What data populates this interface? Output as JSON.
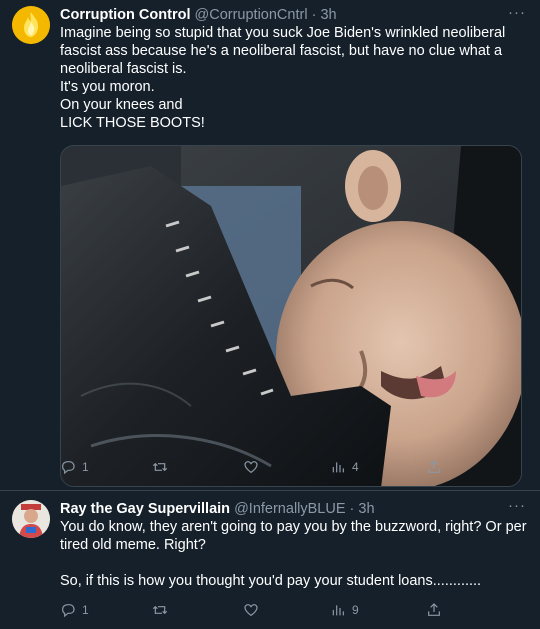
{
  "tweets": [
    {
      "display_name": "Corruption Control",
      "handle": "@CorruptionCntrl",
      "separator": "·",
      "time": "3h",
      "more_label": "···",
      "text_lines": [
        "Imagine being so stupid that you suck Joe Biden's wrinkled neoliberal",
        "fascist ass because he's a neoliberal fascist, but have no clue what a",
        "neoliberal fascist is.",
        "It's you moron.",
        "On your knees and",
        "LICK THOSE BOOTS!"
      ],
      "media": {
        "icon": "photo-man-licking-boot"
      },
      "stats": {
        "replies": "1",
        "retweets": "",
        "likes": "",
        "views": "4"
      }
    },
    {
      "display_name": "Ray the Gay Supervillain",
      "handle": "@InfernallyBLUE",
      "separator": "·",
      "time": "3h",
      "more_label": "···",
      "text_lines": [
        "You do know, they aren't going to pay you by the buzzword, right? Or per",
        "tired old meme. Right?",
        "",
        "So, if this is how you thought you'd pay your student loans............"
      ],
      "stats": {
        "replies": "1",
        "retweets": "",
        "likes": "",
        "views": "9"
      }
    }
  ],
  "colors": {
    "background": "#15202b",
    "text": "#ffffff",
    "secondary_text": "#8b98a5",
    "divider": "#38444d"
  }
}
